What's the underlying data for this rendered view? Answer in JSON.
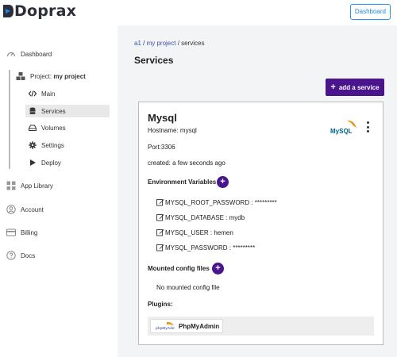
{
  "brand": {
    "name": "Doprax"
  },
  "header": {
    "dashboard_label": "Dashboard"
  },
  "sidebar": {
    "dashboard": "Dashboard",
    "project_prefix": "Project:",
    "project_name": "my project",
    "sub_items": [
      {
        "label": "Main",
        "icon": "code-icon"
      },
      {
        "label": "Services",
        "icon": "database-icon"
      },
      {
        "label": "Volumes",
        "icon": "drive-icon"
      },
      {
        "label": "Settings",
        "icon": "gear-icon"
      },
      {
        "label": "Deploy",
        "icon": "play-icon"
      }
    ],
    "app_library": "App Library",
    "account": "Account",
    "billing": "Billing",
    "docs": "Docs"
  },
  "breadcrumb": {
    "a1": "a1",
    "sep1": " / ",
    "project": "my project",
    "sep2": " / ",
    "current": "services"
  },
  "page": {
    "title": "Services",
    "add_service_label": "add a service"
  },
  "service": {
    "name": "Mysql",
    "hostname": "Hostname: mysql",
    "port": "Port:3306",
    "created": "created: a few seconds ago",
    "logo_text": "MySQL",
    "env_title": "Environment Variables",
    "env_vars": [
      "MYSQL_ROOT_PASSWORD : *********",
      "MYSQL_DATABASE : mydb",
      "MYSQL_USER : hemen",
      "MYSQL_PASSWORD : *********"
    ],
    "mounted_title": "Mounted config files",
    "no_mounted": "No mounted config file",
    "plugins_title": "Plugins:",
    "plugin_label": "PhpMyAdmin",
    "plugin_logo_text": "phpMyAdmin"
  },
  "colors": {
    "accent": "#4a148c",
    "link": "#3f51b5",
    "dashboard_border": "#2196f3"
  }
}
